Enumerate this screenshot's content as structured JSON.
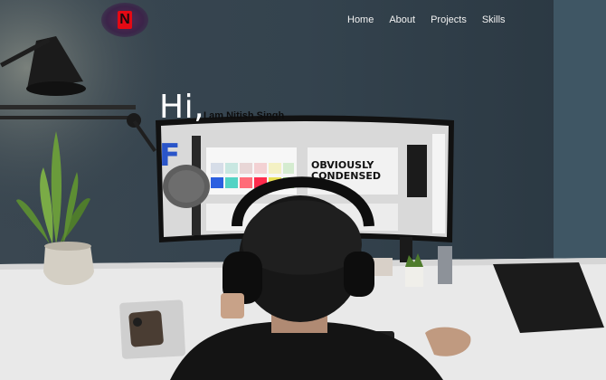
{
  "logo": {
    "letter": "N",
    "brand_color": "#e50914"
  },
  "nav": {
    "items": [
      {
        "label": "Home"
      },
      {
        "label": "About"
      },
      {
        "label": "Projects"
      },
      {
        "label": "Skills"
      }
    ]
  },
  "hero": {
    "greeting": "Hi,",
    "intro": "I am Nitish Singh",
    "typed_text": "F",
    "monitor_text": "OBVIOUSLY CONDENSED"
  },
  "colors": {
    "wall": "#2f3d47",
    "desk": "#ececec",
    "accent_blue": "#2a55c9"
  }
}
